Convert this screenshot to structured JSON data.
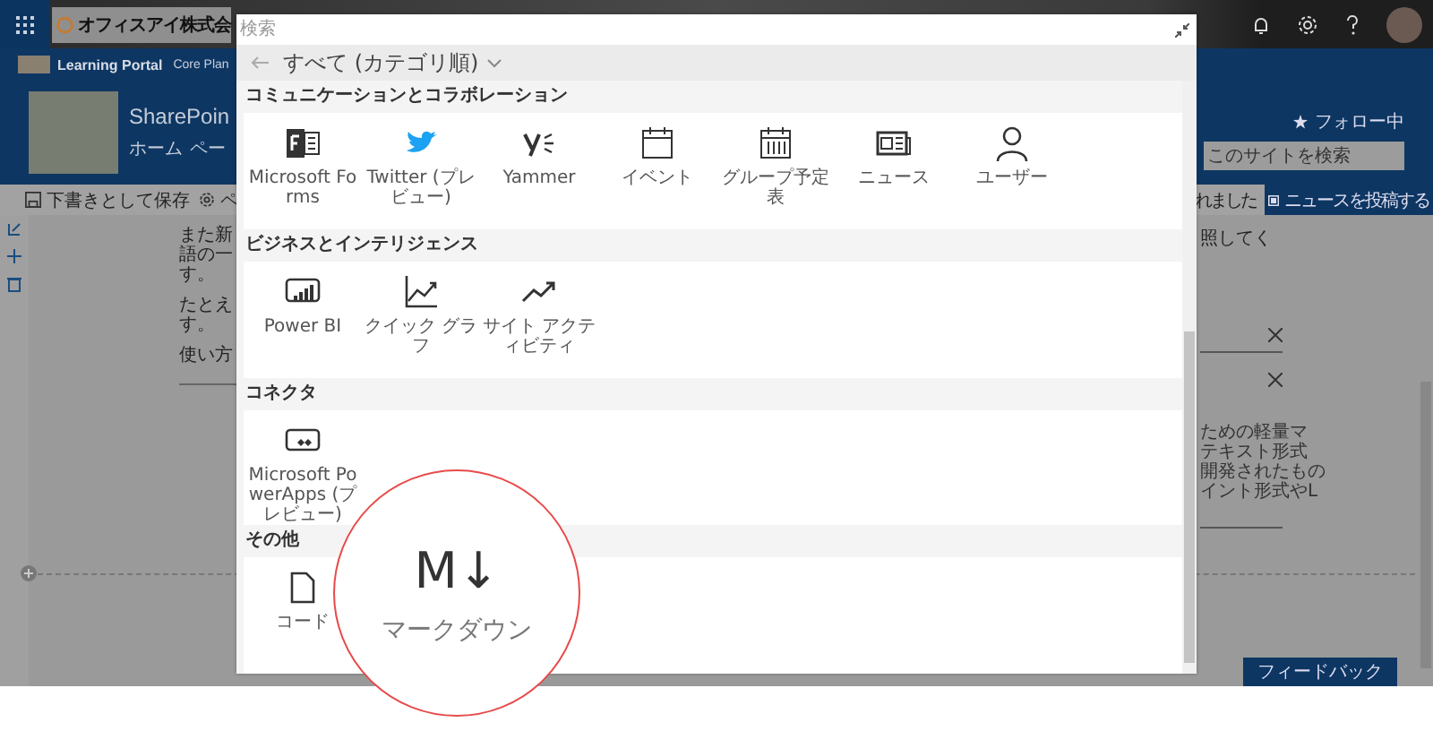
{
  "suite_bar": {
    "company": "オフィスアイ株式会"
  },
  "site_nav": {
    "site_name": "Learning Portal",
    "links": [
      "Core Plan"
    ]
  },
  "header": {
    "title": "SharePoin",
    "nav": [
      "ホーム",
      "ペー"
    ],
    "follow": "フォロー中",
    "search": {
      "placeholder": "このサイトを検索"
    }
  },
  "command_bar": {
    "save": "下書きとして保存",
    "page": "ペ",
    "status": "れました",
    "post_news": "ニュースを投稿する"
  },
  "content": {
    "paragraphs": [
      [
        "また新",
        "語の一",
        "す。"
      ],
      [
        "たとえ",
        "す。"
      ],
      [
        "使い方"
      ]
    ],
    "right_text": "照してく",
    "panel_lines": [
      "ための軽量マ",
      "テキスト形式",
      "開発されたもの",
      "イント形式やL"
    ],
    "feedback": "フィードバック"
  },
  "picker": {
    "search": {
      "placeholder": "検索"
    },
    "heading": "すべて (カテゴリ順)",
    "sections": [
      {
        "title": "コミュニケーションとコラボレーション",
        "items": [
          {
            "label": "Microsoft Forms"
          },
          {
            "label": "Twitter (プレビュー)"
          },
          {
            "label": "Yammer"
          },
          {
            "label": "イベント"
          },
          {
            "label": "グループ予定表"
          },
          {
            "label": "ニュース"
          },
          {
            "label": "ユーザー"
          }
        ]
      },
      {
        "title": "ビジネスとインテリジェンス",
        "items": [
          {
            "label": "Power BI"
          },
          {
            "label": "クイック グラフ"
          },
          {
            "label": "サイト アクティビティ"
          }
        ]
      },
      {
        "title": "コネクタ",
        "items": [
          {
            "label": "Microsoft PowerApps (プレビュー)"
          }
        ]
      },
      {
        "title": "その他",
        "items": [
          {
            "label": "コード"
          }
        ]
      }
    ]
  },
  "magnifier": {
    "icon_text": "M↓",
    "label": "マークダウン"
  }
}
